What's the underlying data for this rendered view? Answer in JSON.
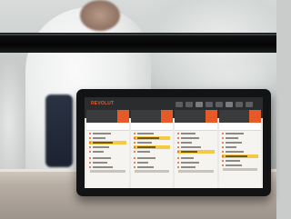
{
  "app": {
    "brand_label": "REVOLUT"
  },
  "colors": {
    "accent": "#e65a28",
    "highlight": "#f6c945",
    "topbar": "#2b2c2e"
  },
  "ticket_columns": [
    {
      "name": "column-1"
    },
    {
      "name": "column-2"
    },
    {
      "name": "column-3"
    },
    {
      "name": "column-4"
    }
  ]
}
